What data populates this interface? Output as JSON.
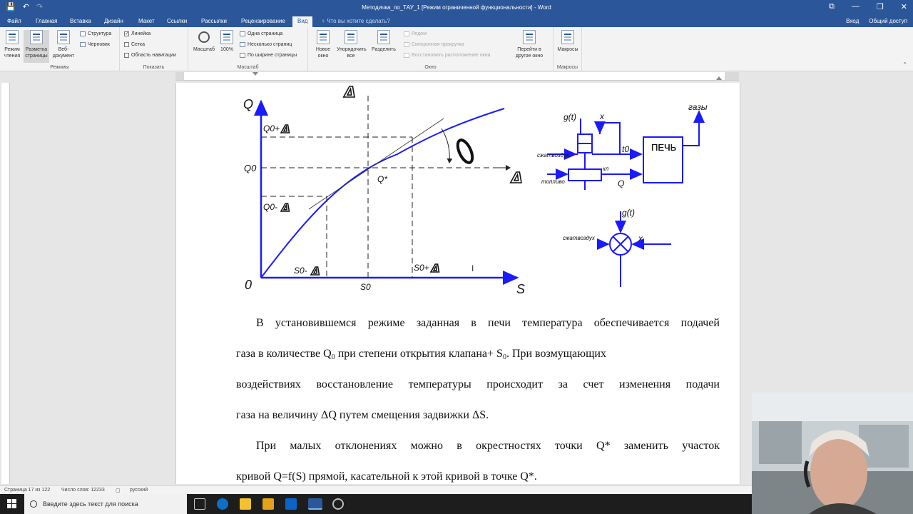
{
  "titlebar": {
    "title": "Методичка_по_ТАУ_1 [Режим ограниченной функциональности] - Word",
    "qat_save": "💾",
    "qat_undo": "↶",
    "qat_redo": "↷",
    "win_display": "⧉",
    "win_min": "—",
    "win_max": "❐",
    "win_close": "✕"
  },
  "tabs": [
    {
      "label": "Файл"
    },
    {
      "label": "Главная"
    },
    {
      "label": "Вставка"
    },
    {
      "label": "Дизайн"
    },
    {
      "label": "Макет"
    },
    {
      "label": "Ссылки"
    },
    {
      "label": "Рассылки"
    },
    {
      "label": "Рецензирование"
    },
    {
      "label": "Вид"
    }
  ],
  "tellme": "♀ Что вы хотите сделать?",
  "account": {
    "signin": "Вход",
    "share": "Общий доступ"
  },
  "ribbon": {
    "modes": {
      "read_mode": "Режим чтения",
      "print_layout": "Разметка страницы",
      "web_layout": "Веб-документ",
      "outline": "Структура",
      "draft": "Черновик",
      "group": "Режимы"
    },
    "show": {
      "ruler": "Линейка",
      "gridlines": "Сетка",
      "nav_pane": "Область навигации",
      "group": "Показать"
    },
    "zoom": {
      "zoom": "Масштаб",
      "pct": "100%",
      "one_page": "Одна страница",
      "multi_page": "Несколько страниц",
      "page_width": "По ширине страницы",
      "group": "Масштаб"
    },
    "window": {
      "new_window": "Новое окно",
      "arrange_all": "Упорядочить все",
      "split": "Разделить",
      "side_by_side": "Рядом",
      "sync_scroll": "Синхронная прокрутка",
      "reset_pos": "Восстановить расположение окна",
      "switch": "Перейти в другое окно",
      "group": "Окно"
    },
    "macros": {
      "macros": "Макросы",
      "group": "Макросы"
    }
  },
  "diagram": {
    "graph": {
      "y_axis": "Q",
      "x_axis": "S",
      "origin": "0",
      "q0": "Q0",
      "q0_plus": "Q0+",
      "q0_minus": "Q0-",
      "s0": "S0",
      "s0_plus": "S0+",
      "s0_minus": "S0-",
      "q_star": "Q*",
      "delta": "Δ"
    },
    "scheme": {
      "gases": "газы",
      "gt": "g(t)",
      "x": "x",
      "t0": "t0",
      "furnace": "ПЕЧЬ",
      "air": "сжатвоздух",
      "fuel": "топливо",
      "valve": "кл",
      "q": "Q"
    },
    "junction": {
      "gt": "g(t)",
      "air": "сжатвоздух",
      "x": "x"
    }
  },
  "text": {
    "p1_l1": "В установившемся режиме заданная в печи температура обеспечивается подачей",
    "p1_l2a": "газа в количестве Q",
    "p1_l2sub": "0",
    "p1_l2b": " при степени открытия клапана+ S",
    "p1_l2sub2": "0",
    "p1_l2c": ". При возмущающих",
    "p1_l3": "воздействиях восстановление температуры происходит за счет изменения подачи",
    "p1_l4": "газа на величину ΔQ путем смещения задвижки ΔS.",
    "p2_l1": "При малых отклонениях можно в окрестностях точки Q* заменить участок",
    "p2_l2": "кривой Q=f(S) прямой, касательной к этой кривой в точке Q*."
  },
  "status": {
    "page": "Страница 17 из 122",
    "words": "Число слов: 12233",
    "lang": "русский"
  },
  "taskbar": {
    "search_placeholder": "Введите здесь текст для поиска"
  }
}
